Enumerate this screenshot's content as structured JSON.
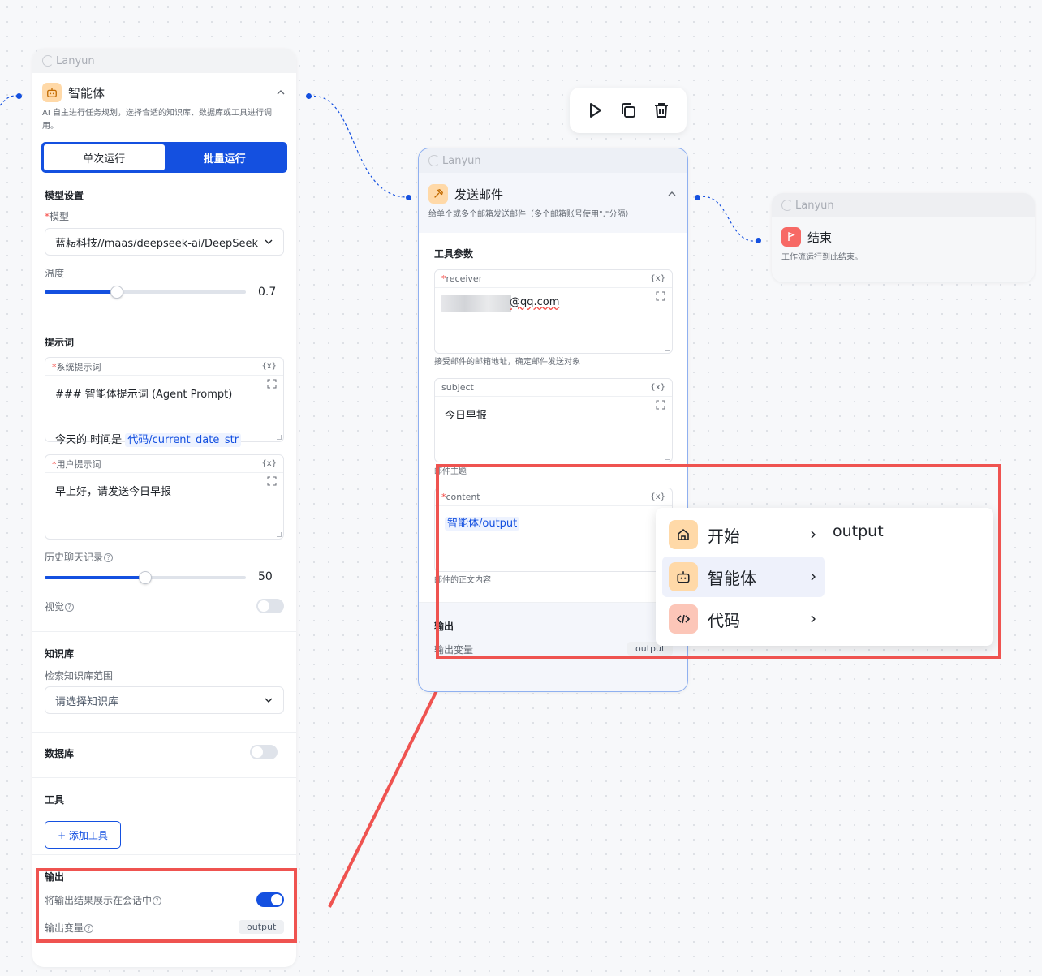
{
  "brand": "Lanyun",
  "colors": {
    "primary": "#1450e0",
    "highlight": "#ef5350",
    "agent_icon_bg": "#ffd9a8",
    "end_icon_bg": "#f76965"
  },
  "agent": {
    "title": "智能体",
    "desc": "AI 自主进行任务规划，选择合适的知识库、数据库或工具进行调用。",
    "tab_single": "单次运行",
    "tab_batch": "批量运行",
    "model_section": "模型设置",
    "model_label": "模型",
    "model_value": "蓝耘科技//maas/deepseek-ai/DeepSeek",
    "temp_label": "温度",
    "temp_value": "0.7",
    "temp_fraction": 0.36,
    "prompt_section": "提示词",
    "system_prompt_label": "系统提示词",
    "system_prompt_line1": "### 智能体提示词 (Agent Prompt)",
    "system_prompt_line2_prefix": "今天的 时间是 ",
    "system_prompt_line2_ref": "代码/current_date_str",
    "user_prompt_label": "用户提示词",
    "user_prompt_value": "早上好，请发送今日早报",
    "var_tag": "{x}",
    "history_label": "历史聊天记录",
    "history_value": "50",
    "history_fraction": 0.5,
    "vision_label": "视觉",
    "vision_on": false,
    "kb_section": "知识库",
    "kb_scope_label": "检索知识库范围",
    "kb_placeholder": "请选择知识库",
    "db_section": "数据库",
    "db_on": false,
    "tools_section": "工具",
    "add_tool": "+ 添加工具",
    "output_section": "输出",
    "show_output_label": "将输出结果展示在会话中",
    "show_output_on": true,
    "output_var_label": "输出变量",
    "output_var": "output"
  },
  "toolbar": {
    "run": "play-icon",
    "copy": "copy-icon",
    "delete": "trash-icon"
  },
  "email": {
    "title": "发送邮件",
    "desc": "给单个或多个邮箱发送邮件（多个邮箱账号使用\",\"分隔）",
    "params_section": "工具参数",
    "receiver_label": "receiver",
    "receiver_value": "@qq.com",
    "receiver_hint": "接受邮件的邮箱地址，确定邮件发送对象",
    "subject_label": "subject",
    "subject_value": "今日早报",
    "subject_hint": "邮件主题",
    "content_label": "content",
    "content_ref": "智能体/output",
    "content_hint": "邮件的正文内容",
    "output_section": "输出",
    "output_var_label": "输出变量",
    "output_var": "output",
    "var_tag": "{x}"
  },
  "end": {
    "title": "结束",
    "desc": "工作流运行到此结束。"
  },
  "dropdown": {
    "items": [
      {
        "label": "开始",
        "icon": "home-icon"
      },
      {
        "label": "智能体",
        "icon": "robot-icon"
      },
      {
        "label": "代码",
        "icon": "code-icon"
      }
    ],
    "sub_value": "output"
  }
}
